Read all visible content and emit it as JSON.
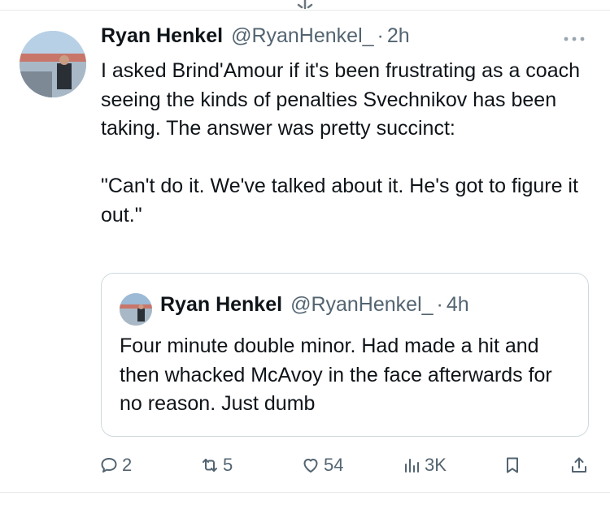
{
  "tweet": {
    "author_name": "Ryan Henkel",
    "author_handle": "@RyanHenkel_",
    "separator": "·",
    "time": "2h",
    "text": "I asked Brind'Amour if it's been frustrating as a coach seeing the kinds of penalties Svechnikov has been taking. The answer was pretty succinct:\n\n\"Can't do it. We've talked about it. He's got to figure it out.\""
  },
  "quoted_tweet": {
    "author_name": "Ryan Henkel",
    "author_handle": "@RyanHenkel_",
    "separator": "·",
    "time": "4h",
    "text": "Four minute double minor. Had made a hit and then whacked McAvoy in the face afterwards for no reason. Just dumb"
  },
  "actions": {
    "replies": "2",
    "reposts": "5",
    "likes": "54",
    "views": "3K"
  },
  "icons": {
    "more": "more-icon",
    "reply": "reply-icon",
    "repost": "repost-icon",
    "like": "heart-icon",
    "views": "views-icon",
    "bookmark": "bookmark-icon",
    "share": "share-icon"
  },
  "colors": {
    "text_primary": "#0f1419",
    "text_secondary": "#536471",
    "border": "#cfd9de",
    "divider": "#e7e9ea"
  }
}
